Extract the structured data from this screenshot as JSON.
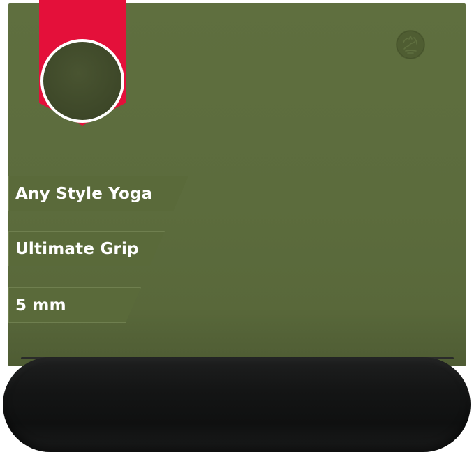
{
  "product": {
    "mat_color": "#5e6e3e",
    "roll_color": "#141515",
    "swatch_color": "#3d4728",
    "ribbon_color": "#e4103a",
    "logo": "lotus-figure-logo-icon"
  },
  "features": [
    {
      "label": "Any Style Yoga"
    },
    {
      "label": "Ultimate Grip"
    },
    {
      "label": "5 mm"
    }
  ]
}
